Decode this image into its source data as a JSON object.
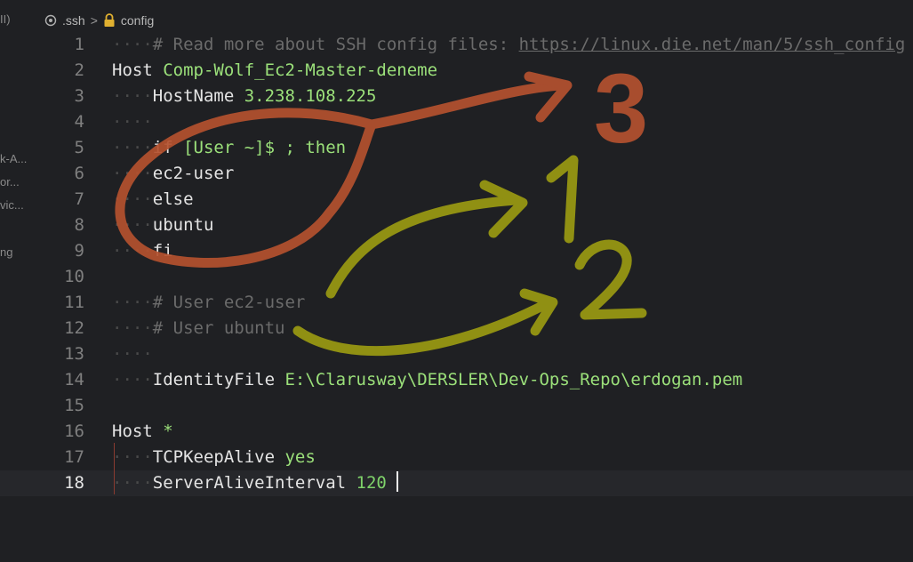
{
  "breadcrumb": {
    "folder": ".ssh",
    "file": "config",
    "separator": ">",
    "folder_icon": "circle-icon",
    "file_icon": "lock-icon"
  },
  "sidebar": {
    "fragments": [
      "II)",
      "k-A...",
      "or...",
      "vic...",
      "ng"
    ]
  },
  "editor": {
    "current_line": 18,
    "lines": [
      {
        "n": "1",
        "ws": "····",
        "comment": "# Read more about SSH config files: ",
        "url": "https://linux.die.net/man/5/ssh_config"
      },
      {
        "n": "2",
        "kw": "Host ",
        "val": "Comp-Wolf_Ec2-Master-deneme"
      },
      {
        "n": "3",
        "ws": "····",
        "kw": "HostName ",
        "val": "3.238.108.225"
      },
      {
        "n": "4",
        "ws": "····"
      },
      {
        "n": "5",
        "ws": "····",
        "kw": "if ",
        "val": "[User ~]$ ; then"
      },
      {
        "n": "6",
        "ws": "····",
        "kw": "ec2-user"
      },
      {
        "n": "7",
        "ws": "····",
        "kw": "else"
      },
      {
        "n": "8",
        "ws": "····",
        "kw": "ubuntu"
      },
      {
        "n": "9",
        "ws": "····",
        "kw": "fi"
      },
      {
        "n": "10"
      },
      {
        "n": "11",
        "ws": "····",
        "comment": "# User ec2-user"
      },
      {
        "n": "12",
        "ws": "····",
        "comment": "# User ubuntu"
      },
      {
        "n": "13",
        "ws": "····"
      },
      {
        "n": "14",
        "ws": "····",
        "kw": "IdentityFile ",
        "val": "E:\\Clarusway\\DERSLER\\Dev-Ops_Repo\\erdogan.pem"
      },
      {
        "n": "15"
      },
      {
        "n": "16",
        "kw": "Host ",
        "val": "*"
      },
      {
        "n": "17",
        "ws": "····",
        "kw": "TCPKeepAlive ",
        "val": "yes"
      },
      {
        "n": "18",
        "ws": "····",
        "kw": "ServerAliveInterval ",
        "num": "120"
      }
    ]
  },
  "annotations": {
    "labels": [
      "3",
      "1",
      "2"
    ],
    "colors": {
      "orange": "#b4512f",
      "olive": "#9a9a12"
    }
  }
}
